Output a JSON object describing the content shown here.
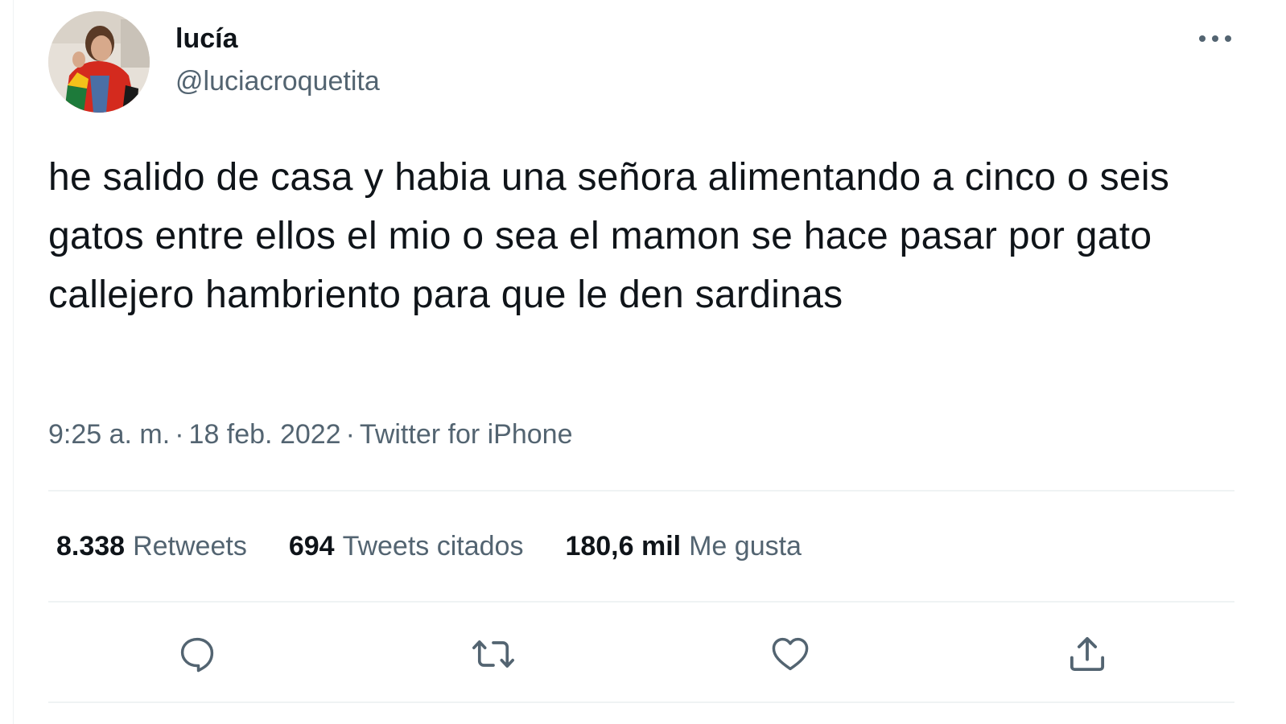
{
  "user": {
    "display_name": "lucía",
    "handle": "@luciacroquetita",
    "avatar_icon": "profile-photo"
  },
  "more_icon": "more-horizontal-icon",
  "tweet": {
    "text": "he salido de casa y habia una señora alimentando a cinco o seis gatos entre ellos el mio o sea el mamon se hace pasar por gato callejero hambriento para que le den sardinas",
    "time": "9:25 a. m.",
    "date": "18 feb. 2022",
    "separator": "·",
    "source": "Twitter for iPhone"
  },
  "stats": {
    "retweets": {
      "value": "8.338",
      "label": "Retweets"
    },
    "quotes": {
      "value": "694",
      "label": "Tweets citados"
    },
    "likes": {
      "value": "180,6 mil",
      "label": "Me gusta"
    }
  },
  "actions": [
    {
      "icon": "reply-icon"
    },
    {
      "icon": "retweet-icon"
    },
    {
      "icon": "like-icon"
    },
    {
      "icon": "share-icon"
    }
  ],
  "colors": {
    "text_primary": "#0f1419",
    "text_secondary": "#536471",
    "divider": "#eff3f4",
    "background": "#ffffff"
  }
}
